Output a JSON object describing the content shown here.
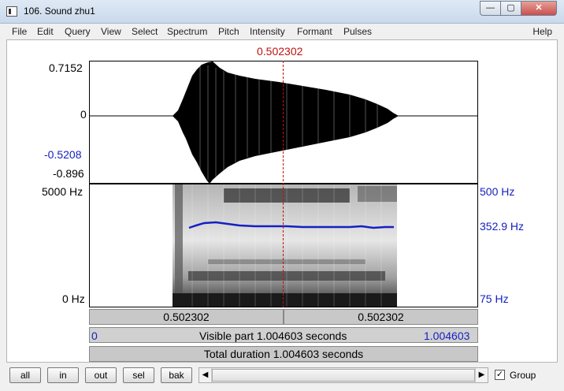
{
  "window": {
    "title": "106. Sound zhu1",
    "min_glyph": "—",
    "max_glyph": "▢",
    "close_glyph": "✕"
  },
  "menu": {
    "items": [
      "File",
      "Edit",
      "Query",
      "View",
      "Select",
      "Spectrum",
      "Pitch",
      "Intensity",
      "Formant",
      "Pulses"
    ],
    "help": "Help"
  },
  "cursor": {
    "time": "0.502302"
  },
  "waveform": {
    "max": "0.7152",
    "zero": "0",
    "sel_min": "-0.5208",
    "min": "-0.896"
  },
  "spectrogram": {
    "top_freq": "5000 Hz",
    "bottom_freq": "0 Hz"
  },
  "pitch": {
    "top": "500 Hz",
    "current": "352.9 Hz",
    "bottom": "75 Hz"
  },
  "time_bars": {
    "left_segment": "0.502302",
    "right_segment": "0.502302",
    "visible_start": "0",
    "visible_label": "Visible part 1.004603 seconds",
    "visible_end": "1.004603",
    "total_label": "Total duration 1.004603 seconds"
  },
  "controls": {
    "buttons": [
      "all",
      "in",
      "out",
      "sel",
      "bak"
    ],
    "scroll_left": "◀",
    "scroll_right": "▶",
    "group_checked": "✓",
    "group_label": "Group"
  },
  "colors": {
    "cursor": "#c01010",
    "pitch_track": "#1520c0",
    "label_blue": "#1520c0"
  }
}
